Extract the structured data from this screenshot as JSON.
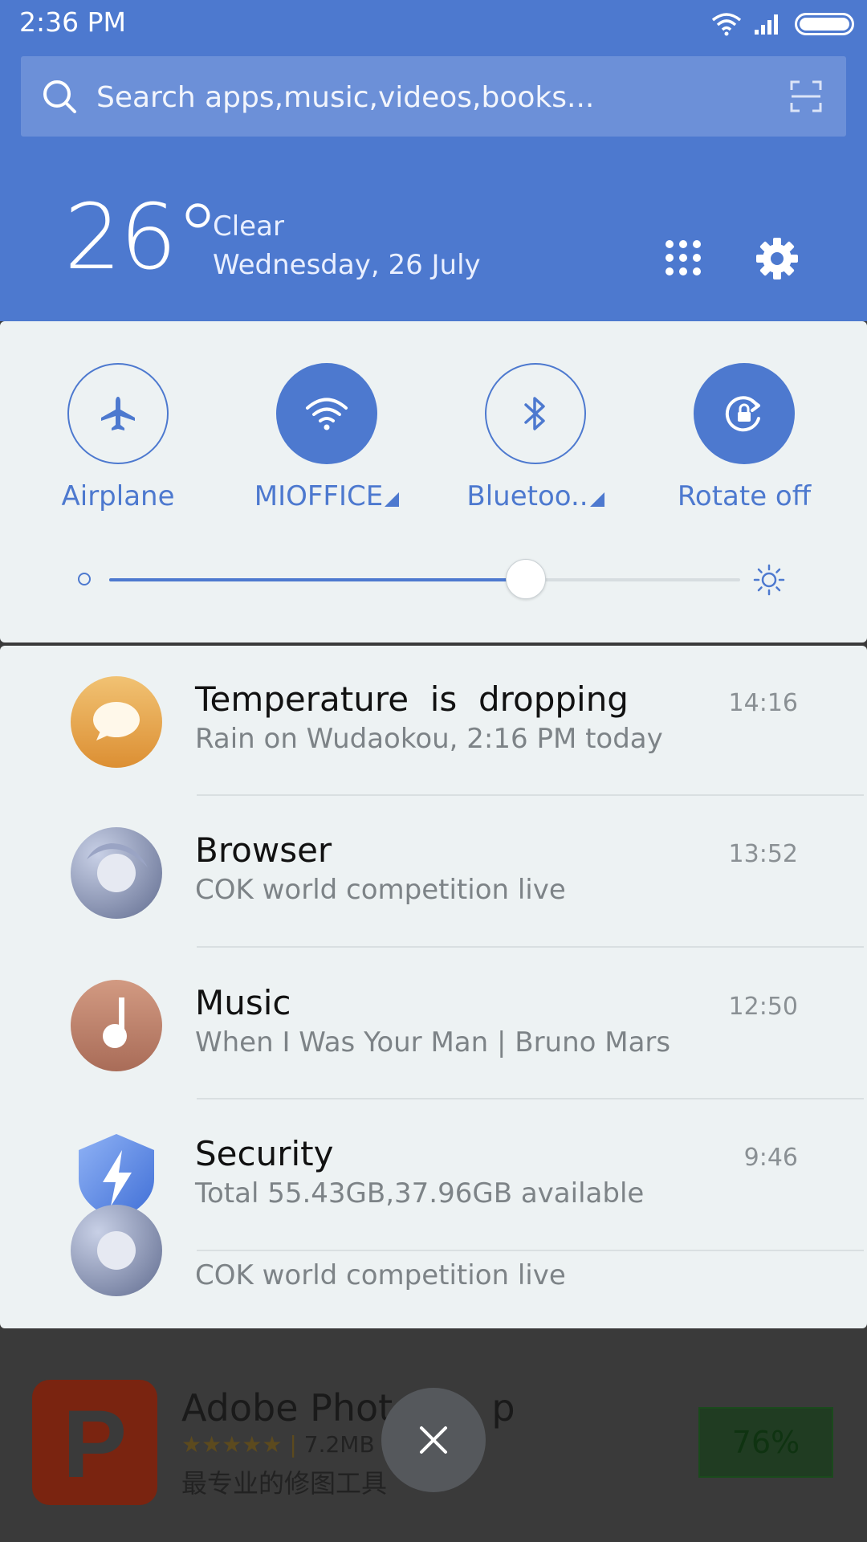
{
  "status_bar": {
    "time": "2:36 PM"
  },
  "search": {
    "placeholder": "Search apps,music,videos,books..."
  },
  "weather": {
    "temperature": "26°",
    "condition": "Clear",
    "date": "Wednesday, 26 July"
  },
  "quick_toggles": [
    {
      "label": "Airplane",
      "icon": "airplane-icon",
      "active": false
    },
    {
      "label": "MIOFFICE",
      "icon": "wifi-icon",
      "active": true,
      "has_dropdown": true
    },
    {
      "label": "Bluetoo..",
      "icon": "bluetooth-icon",
      "active": false,
      "has_dropdown": true
    },
    {
      "label": "Rotate off",
      "icon": "rotation-lock-icon",
      "active": true
    }
  ],
  "brightness": {
    "level": 0.66
  },
  "notifications": [
    {
      "app": "weather",
      "icon": "message-bubble-icon",
      "title": "Temperature  is  dropping",
      "subtitle": "Rain on Wudaokou, 2:16 PM today",
      "time": "14:16"
    },
    {
      "app": "browser",
      "icon": "browser-icon",
      "title": "Browser",
      "subtitle": "COK world competition live",
      "time": "13:52"
    },
    {
      "app": "music",
      "icon": "music-note-icon",
      "title": "Music",
      "subtitle": "When I Was Your Man | Bruno Mars",
      "time": "12:50"
    },
    {
      "app": "security",
      "icon": "shield-bolt-icon",
      "title": "Security",
      "subtitle": "Total 55.43GB,37.96GB available",
      "time": "9:46"
    },
    {
      "app": "browser",
      "icon": "browser-icon",
      "title": "",
      "subtitle": "COK world competition live",
      "time": ""
    }
  ],
  "background_app": {
    "title": "Adobe Photo",
    "title_tail": "p",
    "stars": "★★★★★",
    "size": "7.2MB",
    "description": "最专业的修图工具",
    "progress": "76%"
  },
  "colors": {
    "accent": "#4d79cf",
    "panel": "#edf2f3"
  }
}
